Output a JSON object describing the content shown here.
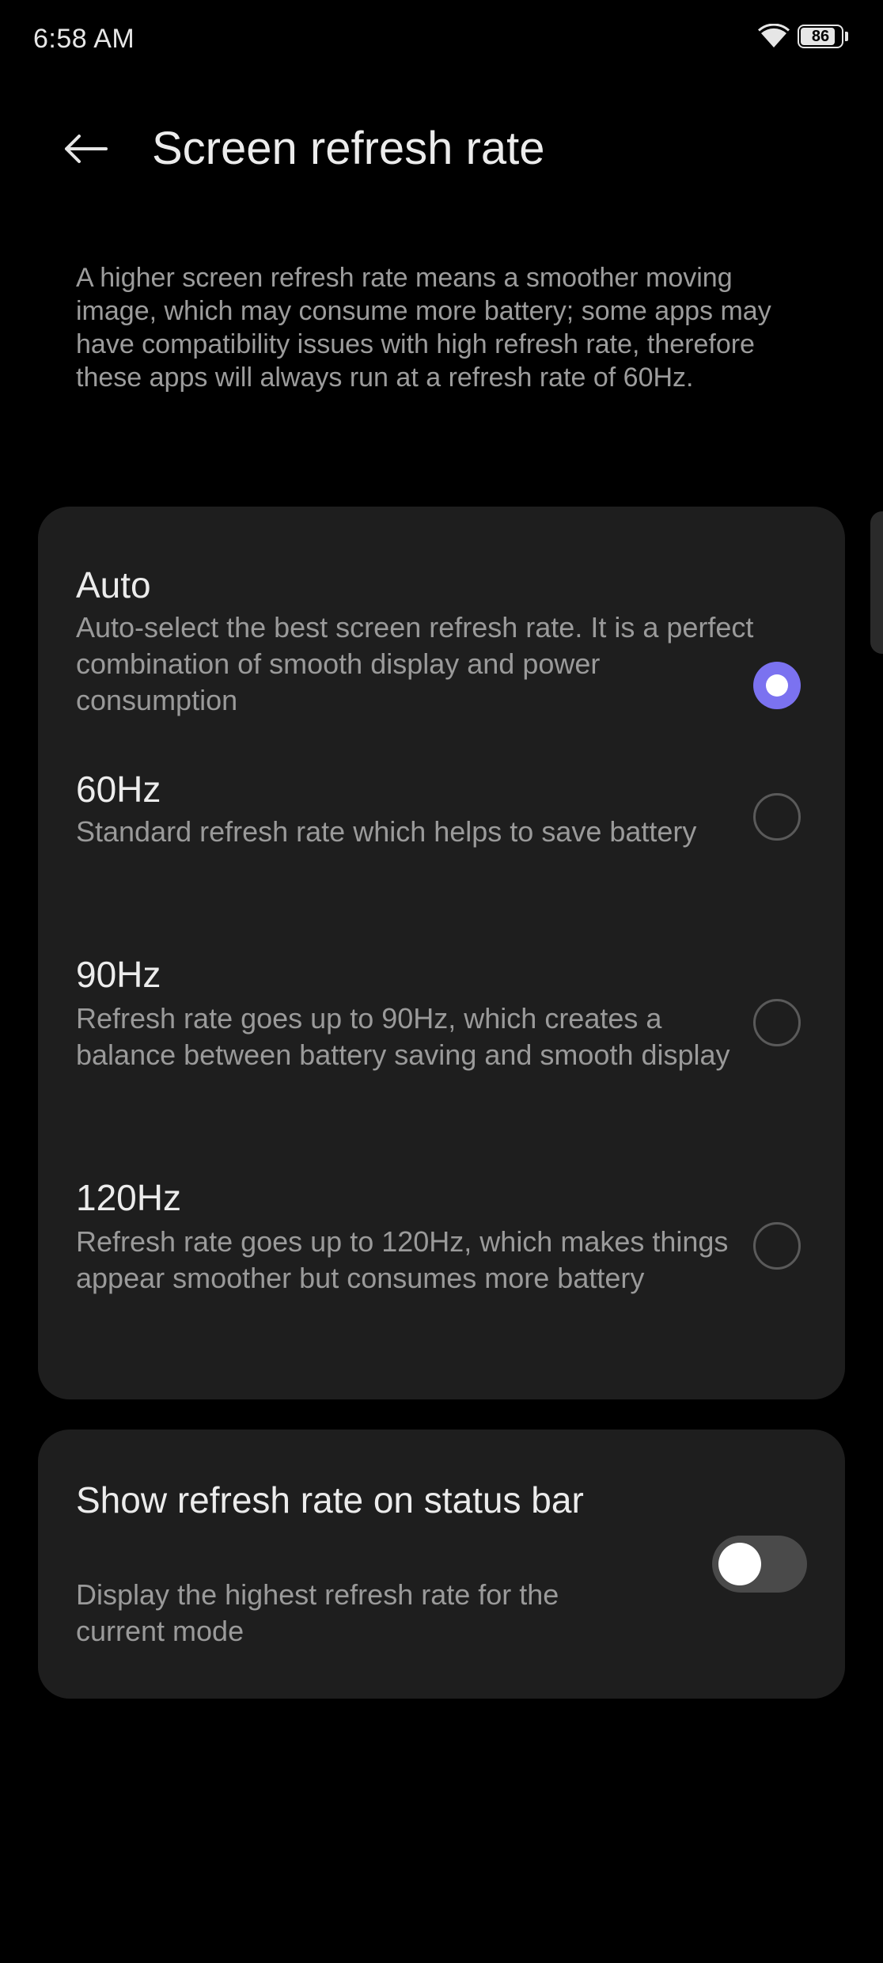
{
  "status_bar": {
    "time": "6:58 AM",
    "battery_level": "86",
    "battery_fraction": 0.86,
    "icons": [
      "wifi-icon",
      "battery-icon"
    ]
  },
  "header": {
    "back_icon": "arrow-left-icon",
    "title": "Screen refresh rate"
  },
  "description": "A higher screen refresh rate means a smoother moving image, which may consume more battery; some apps may have compatibility issues with high refresh rate, therefore these apps will always run at a refresh rate of 60Hz.",
  "refresh_options": [
    {
      "label": "Auto",
      "description": "Auto-select the best screen refresh rate. It is a perfect combination of smooth display and power consumption",
      "selected": true
    },
    {
      "label": "60Hz",
      "description": "Standard refresh rate which helps to save battery",
      "selected": false
    },
    {
      "label": "90Hz",
      "description": "Refresh rate goes up to 90Hz, which creates a balance between battery saving and smooth display",
      "selected": false
    },
    {
      "label": "120Hz",
      "description": "Refresh rate goes up to 120Hz, which makes things appear smoother but consumes more battery",
      "selected": false
    }
  ],
  "status_bar_toggle": {
    "title": "Show refresh rate on status bar",
    "description": "Display the highest refresh rate for the current mode",
    "enabled": false
  },
  "colors": {
    "accent": "#7b72f0",
    "card_background": "#1e1e1e",
    "page_background": "#000000"
  }
}
